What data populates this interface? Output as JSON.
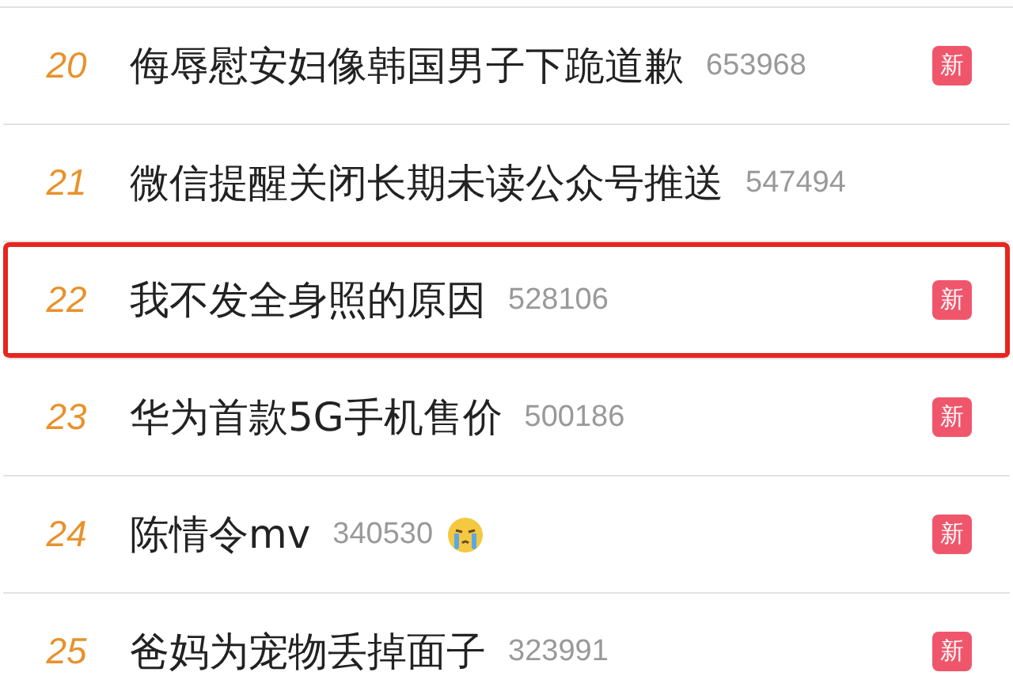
{
  "hot_search": [
    {
      "rank": "20",
      "title": "侮辱慰安妇像韩国男子下跪道歉",
      "count": "653968",
      "emoji": false,
      "badge": "新",
      "highlighted": false
    },
    {
      "rank": "21",
      "title": "微信提醒关闭长期未读公众号推送",
      "count": "547494",
      "emoji": false,
      "highlighted": false
    },
    {
      "rank": "22",
      "title": "我不发全身照的原因",
      "count": "528106",
      "emoji": false,
      "badge": "新",
      "highlighted": true
    },
    {
      "rank": "23",
      "title": "华为首款5G手机售价",
      "count": "500186",
      "emoji": false,
      "badge": "新",
      "highlighted": false
    },
    {
      "rank": "24",
      "title": "陈情令mv",
      "count": "340530",
      "emoji": true,
      "badge": "新",
      "highlighted": false
    },
    {
      "rank": "25",
      "title": "爸妈为宠物丢掉面子",
      "count": "323991",
      "emoji": false,
      "badge": "新",
      "highlighted": false
    }
  ]
}
